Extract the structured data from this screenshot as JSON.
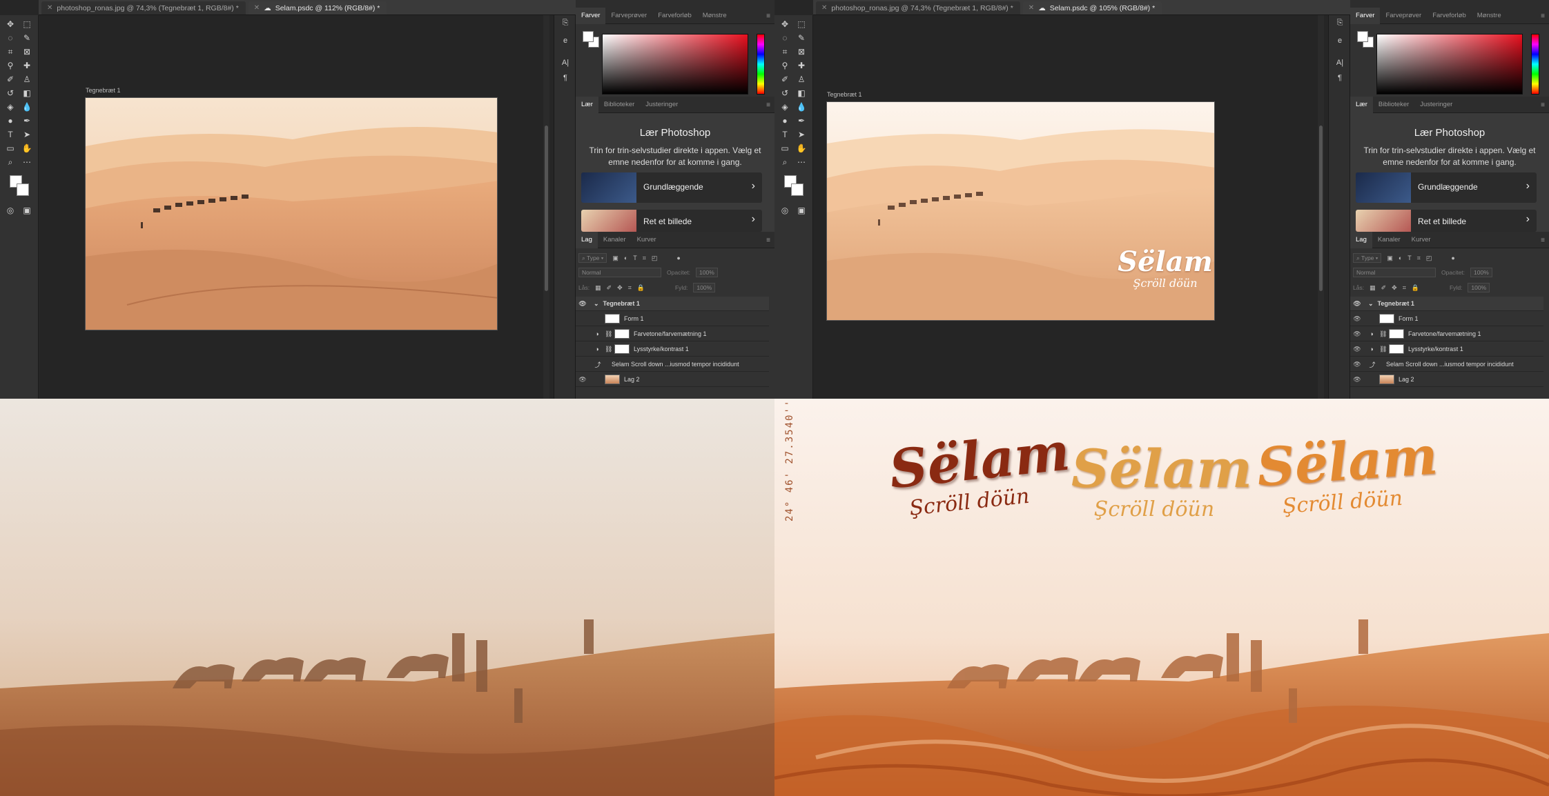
{
  "left_window": {
    "tabs": [
      {
        "label": "photoshop_ronas.jpg @ 74,3% (Tegnebræt 1, RGB/8#) *",
        "active": false
      },
      {
        "label": "Selam.psdc @ 112% (RGB/8#) *",
        "active": true
      }
    ],
    "artboard_label": "Tegnebræt 1"
  },
  "right_window": {
    "tabs": [
      {
        "label": "photoshop_ronas.jpg @ 74,3% (Tegnebræt 1, RGB/8#) *",
        "active": false
      },
      {
        "label": "Selam.psdc @ 105% (RGB/8#) *",
        "active": true
      }
    ],
    "artboard_label": "Tegnebræt 1",
    "canvas_logo": "Sëlam",
    "canvas_logo_sub": "Şcröll döün"
  },
  "color_panel": {
    "tabs": [
      "Farver",
      "Farveprøver",
      "Farveforløb",
      "Mønstre"
    ]
  },
  "learn_panel": {
    "tabs": [
      "Lær",
      "Biblioteker",
      "Justeringer"
    ],
    "title": "Lær Photoshop",
    "description": "Trin for trin-selvstudier direkte i appen. Vælg et emne nedenfor for at komme i gang.",
    "cards": [
      "Grundlæggende",
      "Ret et billede"
    ]
  },
  "layers_panel": {
    "tabs": [
      "Lag",
      "Kanaler",
      "Kurver"
    ],
    "filter_label": "Type",
    "blend_mode": "Normal",
    "opacity_label": "Opacitet:",
    "opacity_value": "100%",
    "lock_label": "Lås:",
    "fill_label": "Fyld:",
    "fill_value": "100%",
    "layers": [
      {
        "name": "Tegnebræt 1",
        "kind": "group"
      },
      {
        "name": "Form 1",
        "kind": "shape"
      },
      {
        "name": "Farvetone/farvemætning 1",
        "kind": "adjustment"
      },
      {
        "name": "Lysstyrke/kontrast 1",
        "kind": "adjustment"
      },
      {
        "name": "Selam    Scroll down    ...iusmod tempor incididunt",
        "kind": "text"
      },
      {
        "name": "Lag 2",
        "kind": "image"
      }
    ]
  },
  "bottom_right": {
    "coordinate_text": "24° 46' 27.3540''",
    "logos": [
      {
        "title": "Sëlam",
        "subtitle": "Şcröll döün"
      },
      {
        "title": "Sëlam",
        "subtitle": "Şcröll döün"
      },
      {
        "title": "Sëlam",
        "subtitle": "Şcröll döün"
      }
    ]
  },
  "colors": {
    "sand_light": "#f1c8a0",
    "sand_dark": "#b86a3a",
    "sky": "#eee6df",
    "logo_dark": "#8a2a12",
    "logo_gold": "#e59a3a"
  }
}
